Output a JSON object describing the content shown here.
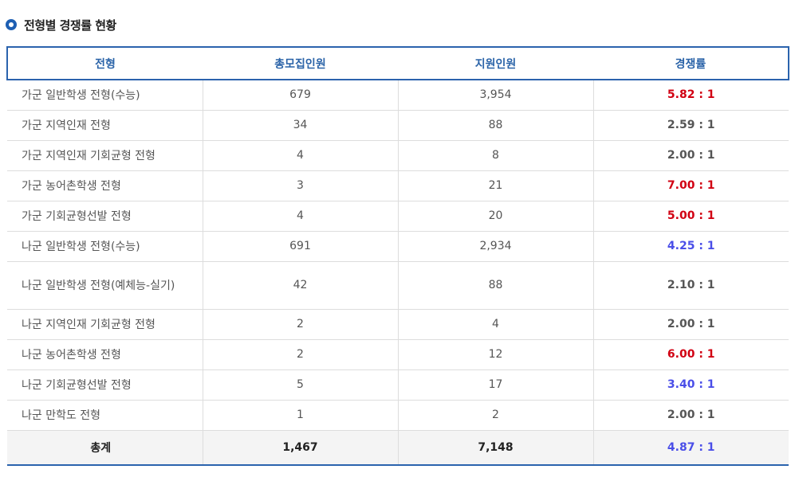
{
  "section": {
    "title": "전형별 경쟁률 현황"
  },
  "table": {
    "headers": [
      "전형",
      "총모집인원",
      "지원인원",
      "경쟁률"
    ],
    "rows": [
      {
        "name": "가군 일반학생 전형(수능)",
        "quota": "679",
        "applicants": "3,954",
        "rate": "5.82 : 1",
        "rate_color": "red"
      },
      {
        "name": "가군 지역인재 전형",
        "quota": "34",
        "applicants": "88",
        "rate": "2.59 : 1",
        "rate_color": "gray"
      },
      {
        "name": "가군 지역인재 기회균형 전형",
        "quota": "4",
        "applicants": "8",
        "rate": "2.00 : 1",
        "rate_color": "gray"
      },
      {
        "name": "가군 농어촌학생 전형",
        "quota": "3",
        "applicants": "21",
        "rate": "7.00 : 1",
        "rate_color": "red"
      },
      {
        "name": "가군 기회균형선발 전형",
        "quota": "4",
        "applicants": "20",
        "rate": "5.00 : 1",
        "rate_color": "red"
      },
      {
        "name": "나군 일반학생 전형(수능)",
        "quota": "691",
        "applicants": "2,934",
        "rate": "4.25 : 1",
        "rate_color": "blue"
      },
      {
        "name": "나군 일반학생 전형(예체능-실기)",
        "quota": "42",
        "applicants": "88",
        "rate": "2.10 : 1",
        "rate_color": "gray"
      },
      {
        "name": "나군 지역인재 기회균형 전형",
        "quota": "2",
        "applicants": "4",
        "rate": "2.00 : 1",
        "rate_color": "gray"
      },
      {
        "name": "나군 농어촌학생 전형",
        "quota": "2",
        "applicants": "12",
        "rate": "6.00 : 1",
        "rate_color": "red"
      },
      {
        "name": "나군 기회균형선발 전형",
        "quota": "5",
        "applicants": "17",
        "rate": "3.40 : 1",
        "rate_color": "blue"
      },
      {
        "name": "나군 만학도 전형",
        "quota": "1",
        "applicants": "2",
        "rate": "2.00 : 1",
        "rate_color": "gray"
      }
    ],
    "total": {
      "name": "총계",
      "quota": "1,467",
      "applicants": "7,148",
      "rate": "4.87 : 1",
      "rate_color": "blue"
    }
  },
  "colors": {
    "accent": "#2b63ad",
    "red": "#d10012",
    "blue": "#4a4ee8",
    "gray": "#555555"
  }
}
